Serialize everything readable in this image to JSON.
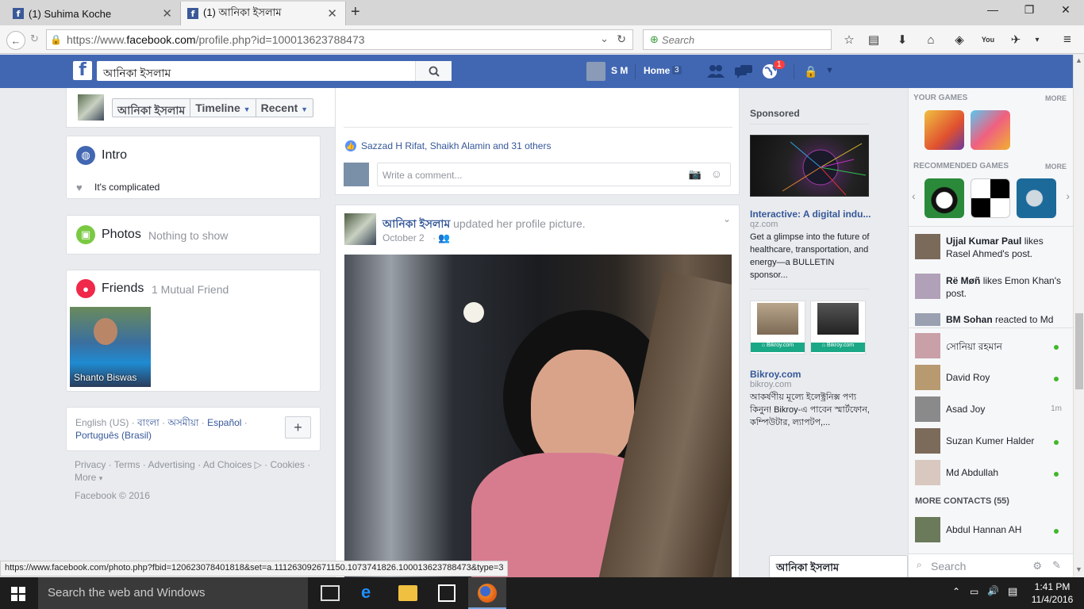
{
  "browser": {
    "tabs": [
      {
        "title": "(1) Suhima Koche",
        "active": false
      },
      {
        "title": "(1) আনিকা ইসলাম",
        "active": true
      }
    ],
    "url_prefix": "https://www.",
    "url_domain": "facebook.com",
    "url_rest": "/profile.php?id=100013623788473",
    "search_placeholder": "Search",
    "status_url": "https://www.facebook.com/photo.php?fbid=120623078401818&set=a.111263092671150.1073741826.100013623788473&type=3"
  },
  "fb_header": {
    "search_value": "আনিকা ইসলাম",
    "user_short": "S M",
    "home_label": "Home",
    "home_count": "3",
    "notif_count": "1",
    "brand_color": "#4267b2"
  },
  "profile_nav": {
    "name": "আনিকা ইসলাম",
    "timeline": "Timeline",
    "recent": "Recent"
  },
  "intro": {
    "title": "Intro",
    "relationship": "It's complicated"
  },
  "photos": {
    "title": "Photos",
    "note": "Nothing to show"
  },
  "friends": {
    "title": "Friends",
    "note": "1 Mutual Friend",
    "friend_name": "Shanto Biswas"
  },
  "languages": {
    "current": "English (US)",
    "others": [
      "বাংলা",
      "অসমীয়া",
      "Español",
      "Português (Brasil)"
    ]
  },
  "footer": {
    "links": [
      "Privacy",
      "Terms",
      "Advertising",
      "Ad Choices",
      "Cookies",
      "More"
    ],
    "copyright": "Facebook © 2016"
  },
  "feed": {
    "likes_text": "Sazzad H Rifat, Shaikh Alamin and 31 others",
    "comment_placeholder": "Write a comment...",
    "post_author": "আনিকা ইসলাম",
    "post_action": "updated her profile picture.",
    "post_date": "October 2"
  },
  "sponsored": {
    "title": "Sponsored",
    "ad1_title": "Interactive: A digital indu...",
    "ad1_domain": "qz.com",
    "ad1_text": "Get a glimpse into the future of healthcare, transportation, and energy—a BULLETIN sponsor...",
    "ad2_title": "Bikroy.com",
    "ad2_domain": "bikroy.com",
    "ad2_text": "আকর্ষণীয় মূল্যে ইলেক্ট্রনিক্স পণ্য কিনুন! Bikroy-এ পাবেন স্মার্টফোন, কম্পিউটার, ল্যাপটপ,..."
  },
  "games": {
    "your_games": "YOUR GAMES",
    "recommended": "RECOMMENDED GAMES",
    "more": "MORE"
  },
  "ticker": [
    {
      "name": "Ujjal Kumar Paul",
      "text": "likes Rasel Ahmed's post."
    },
    {
      "name": "Rë Møñ",
      "text": "likes Emon Khan's post."
    },
    {
      "name": "BM Sohan",
      "text": "reacted to Md"
    }
  ],
  "contacts": [
    {
      "name": "সোনিয়া রহমান",
      "status": "online"
    },
    {
      "name": "David Roy",
      "status": "online"
    },
    {
      "name": "Asad Joy",
      "status": "1m"
    },
    {
      "name": "Suzan Kumer Halder",
      "status": "online"
    },
    {
      "name": "Md Abdullah",
      "status": "online"
    }
  ],
  "more_contacts": "MORE CONTACTS (55)",
  "more_contacts_list": [
    {
      "name": "Abdul Hannan AH",
      "status": "online"
    }
  ],
  "chat": {
    "tab_name": "আনিকা ইসলাম",
    "search_placeholder": "Search"
  },
  "taskbar": {
    "search_text": "Search the web and Windows",
    "time": "1:41 PM",
    "date": "11/4/2016"
  }
}
